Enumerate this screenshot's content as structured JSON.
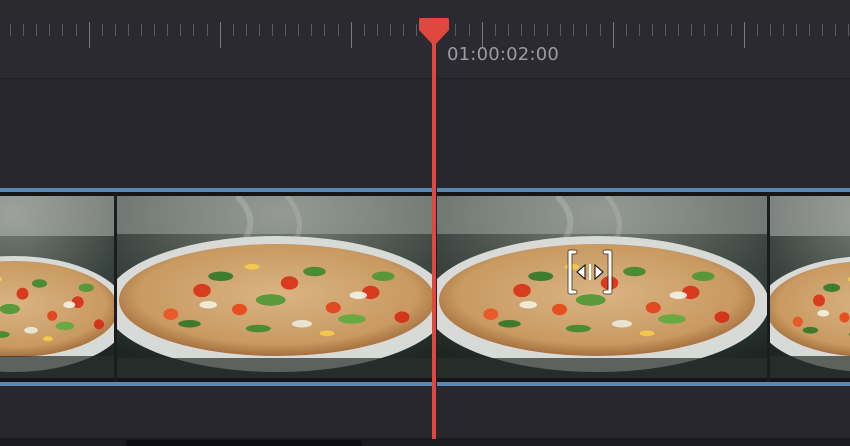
{
  "timeline": {
    "playhead_timecode": "01:00:02:00"
  },
  "colors": {
    "background": "#28272d",
    "ruler": "#2b2a30",
    "playhead": "#e0483f",
    "clip_border": "#5b87b4"
  },
  "icons": {
    "playhead": "playhead-marker-icon",
    "trim": "slip-trim-icon"
  }
}
